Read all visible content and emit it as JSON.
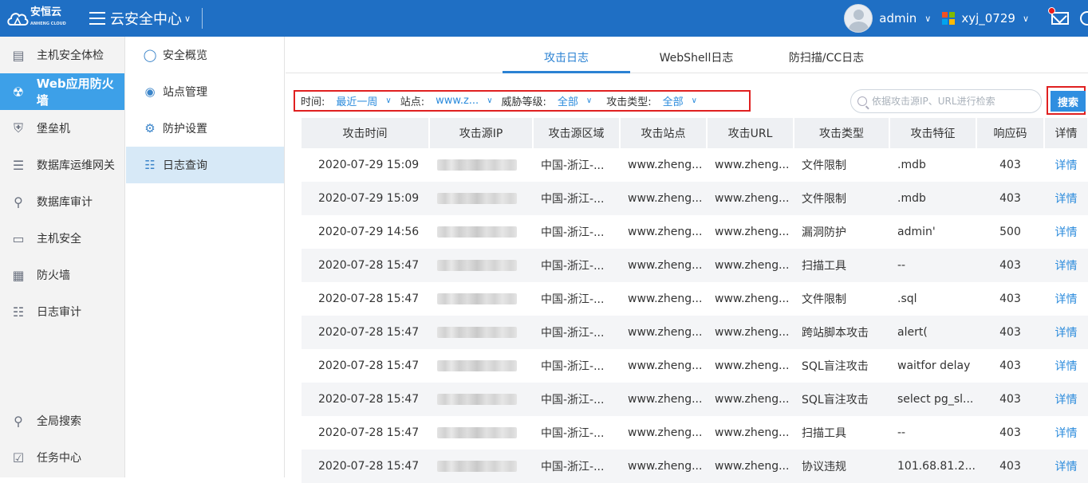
{
  "header": {
    "logo_text": "安恒云",
    "logo_sub": "ANHENG CLOUD",
    "app_title": "云安全中心",
    "username": "admin",
    "tenant": "xyj_0729"
  },
  "sidebar": {
    "items": [
      {
        "label": "主机安全体检",
        "icon": "host-check-icon"
      },
      {
        "label": "Web应用防火墙",
        "icon": "waf-icon"
      },
      {
        "label": "堡垒机",
        "icon": "bastion-icon"
      },
      {
        "label": "数据库运维网关",
        "icon": "database-icon"
      },
      {
        "label": "数据库审计",
        "icon": "db-audit-icon"
      },
      {
        "label": "主机安全",
        "icon": "monitor-icon"
      },
      {
        "label": "防火墙",
        "icon": "firewall-icon"
      },
      {
        "label": "日志审计",
        "icon": "log-audit-icon"
      }
    ],
    "bottom": [
      {
        "label": "全局搜索",
        "icon": "search-icon"
      },
      {
        "label": "任务中心",
        "icon": "task-icon"
      }
    ]
  },
  "subnav": {
    "items": [
      {
        "label": "安全概览"
      },
      {
        "label": "站点管理"
      },
      {
        "label": "防护设置"
      },
      {
        "label": "日志查询"
      }
    ]
  },
  "tabs": [
    {
      "label": "攻击日志"
    },
    {
      "label": "WebShell日志"
    },
    {
      "label": "防扫描/CC日志"
    }
  ],
  "filters": {
    "time_label": "时间:",
    "time_value": "最近一周",
    "site_label": "站点:",
    "site_value": "www.z...",
    "threat_label": "威胁等级:",
    "threat_value": "全部",
    "type_label": "攻击类型:",
    "type_value": "全部"
  },
  "search": {
    "placeholder": "依据攻击源IP、URL进行检索",
    "button": "搜索"
  },
  "table": {
    "headers": [
      "攻击时间",
      "攻击源IP",
      "攻击源区域",
      "攻击站点",
      "攻击URL",
      "攻击类型",
      "攻击特征",
      "响应码",
      "详情"
    ],
    "rows": [
      [
        "2020-07-29 15:09",
        "",
        "中国-浙江-...",
        "www.zheng...",
        "www.zheng...",
        "文件限制",
        ".mdb",
        "403",
        "详情"
      ],
      [
        "2020-07-29 15:09",
        "",
        "中国-浙江-...",
        "www.zheng...",
        "www.zheng...",
        "文件限制",
        ".mdb",
        "403",
        "详情"
      ],
      [
        "2020-07-29 14:56",
        "",
        "中国-浙江-...",
        "www.zheng...",
        "www.zheng...",
        "漏洞防护",
        "admin'",
        "500",
        "详情"
      ],
      [
        "2020-07-28 15:47",
        "",
        "中国-浙江-...",
        "www.zheng...",
        "www.zheng...",
        "扫描工具",
        "--",
        "403",
        "详情"
      ],
      [
        "2020-07-28 15:47",
        "",
        "中国-浙江-...",
        "www.zheng...",
        "www.zheng...",
        "文件限制",
        ".sql",
        "403",
        "详情"
      ],
      [
        "2020-07-28 15:47",
        "",
        "中国-浙江-...",
        "www.zheng...",
        "www.zheng...",
        "跨站脚本攻击",
        "alert(",
        "403",
        "详情"
      ],
      [
        "2020-07-28 15:47",
        "",
        "中国-浙江-...",
        "www.zheng...",
        "www.zheng...",
        "SQL盲注攻击",
        "waitfor delay",
        "403",
        "详情"
      ],
      [
        "2020-07-28 15:47",
        "",
        "中国-浙江-...",
        "www.zheng...",
        "www.zheng...",
        "SQL盲注攻击",
        "select pg_sl...",
        "403",
        "详情"
      ],
      [
        "2020-07-28 15:47",
        "",
        "中国-浙江-...",
        "www.zheng...",
        "www.zheng...",
        "扫描工具",
        "--",
        "403",
        "详情"
      ],
      [
        "2020-07-28 15:47",
        "",
        "中国-浙江-...",
        "www.zheng...",
        "www.zheng...",
        "协议违规",
        "101.68.81.2...",
        "403",
        "详情"
      ]
    ]
  },
  "colors": {
    "header_bg": "#1f6fc4",
    "active_nav": "#3da0e8",
    "accent": "#2b8bdc",
    "highlight_border": "#e02020"
  }
}
